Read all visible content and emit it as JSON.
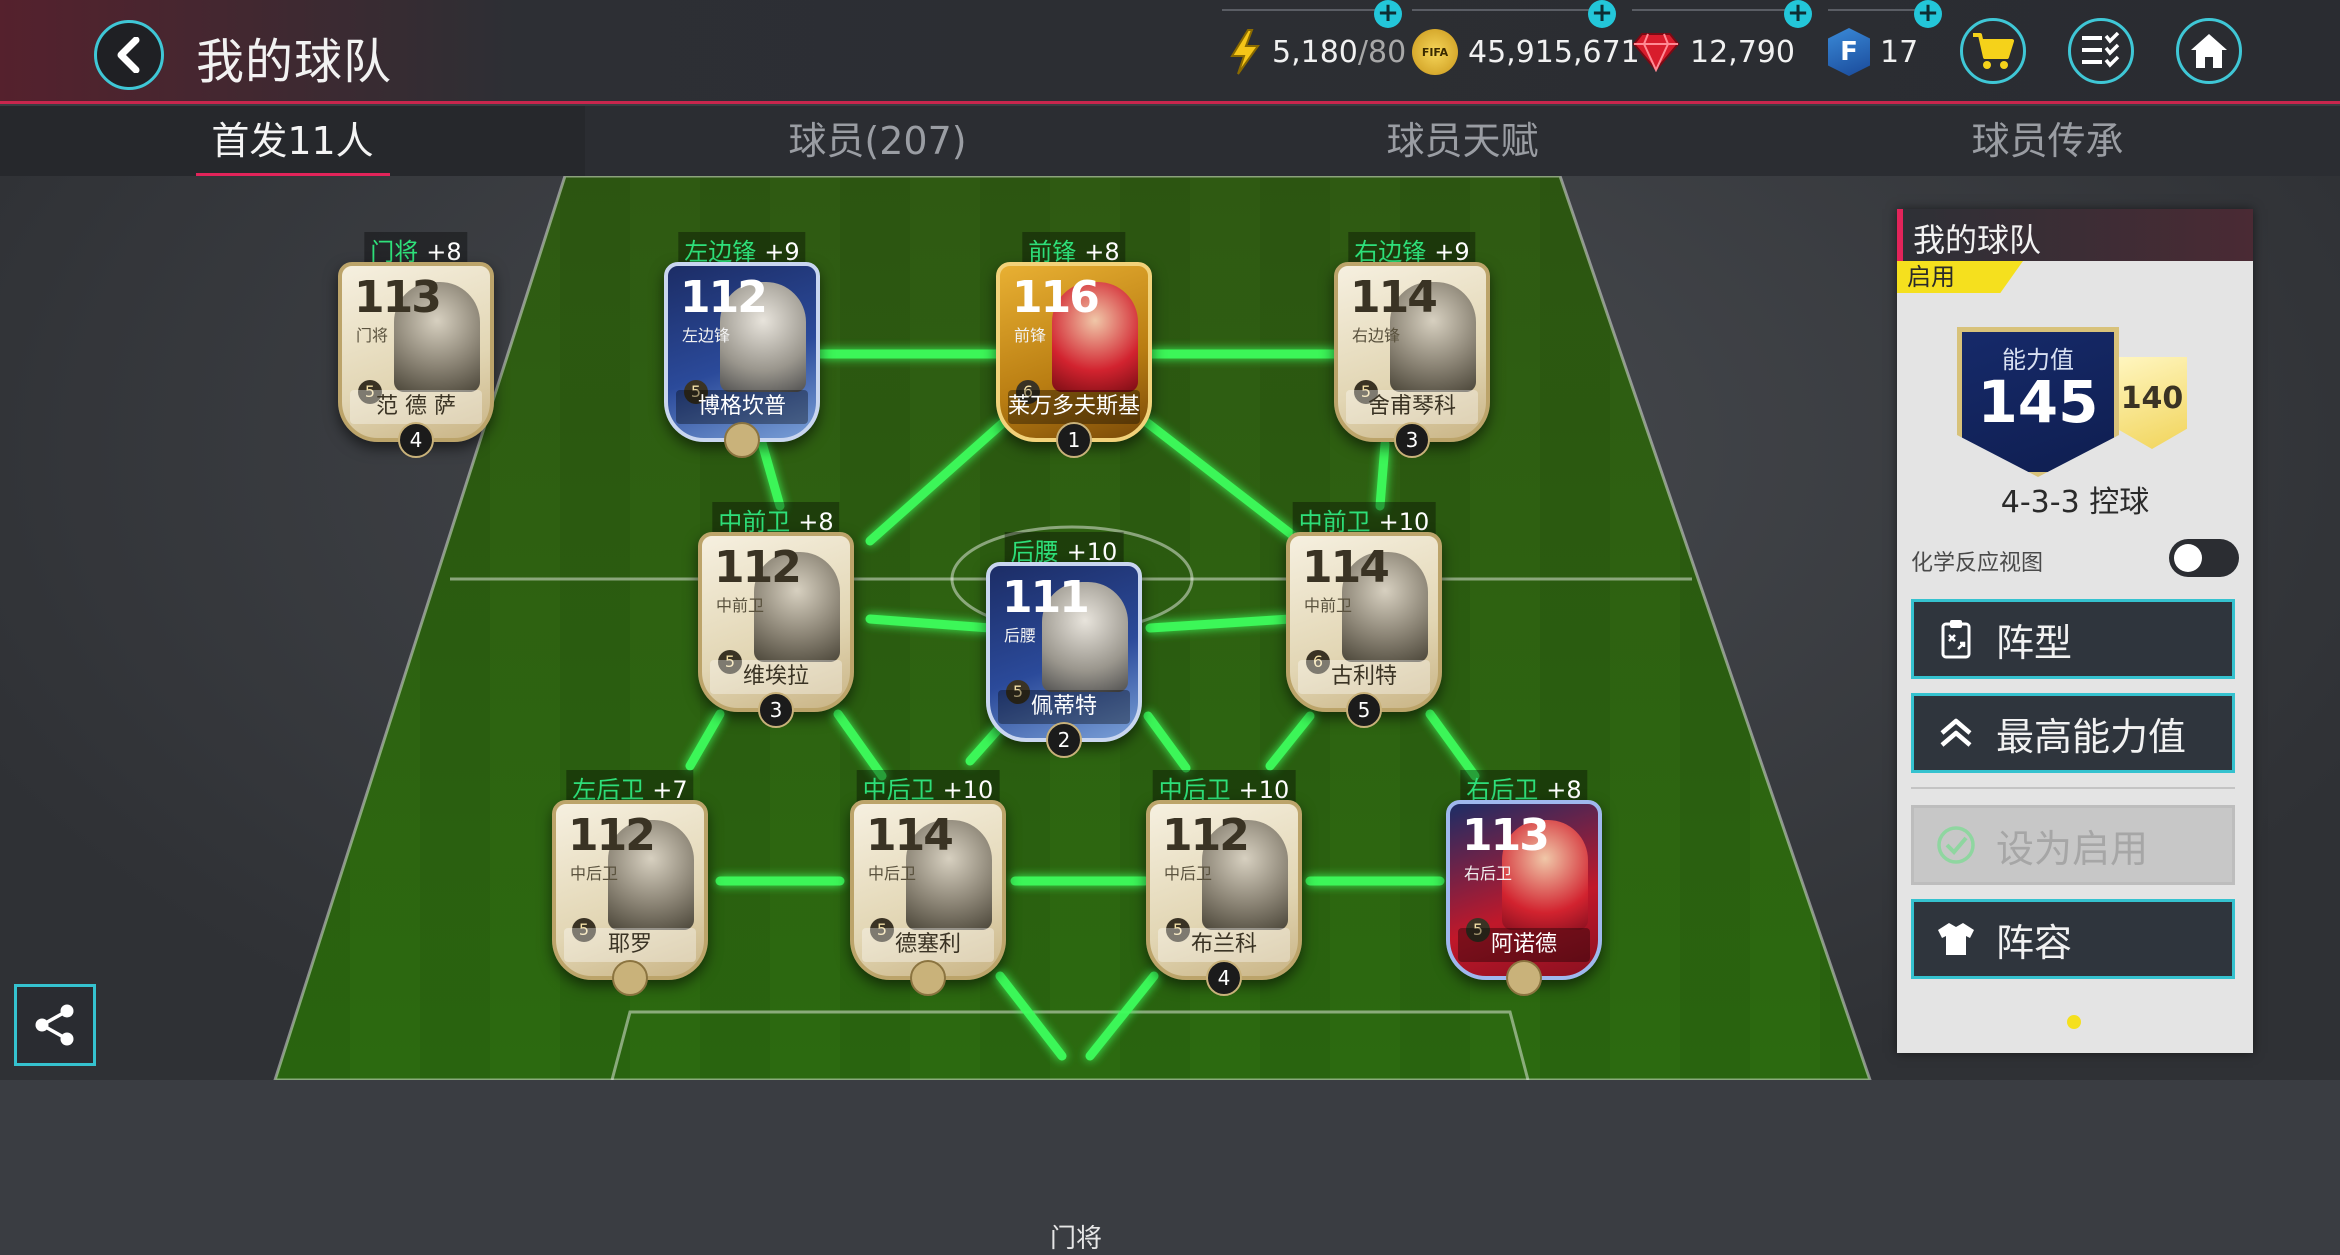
{
  "header": {
    "title": "我的球队",
    "resources": [
      {
        "icon": "lightning-icon",
        "value": "5,180",
        "sub": "/80"
      },
      {
        "icon": "fifa-coin-icon",
        "value": "45,915,671"
      },
      {
        "icon": "ruby-gem-icon",
        "value": "12,790"
      },
      {
        "icon": "fifa-points-icon",
        "value": "17"
      }
    ],
    "coin_icon_text": "FIFA",
    "points_icon_text": "F"
  },
  "tabs": [
    {
      "label": "首发11人",
      "active": true
    },
    {
      "label": "球员(207)",
      "active": false
    },
    {
      "label": "球员天赋",
      "active": false
    },
    {
      "label": "球员传承",
      "active": false
    }
  ],
  "players": [
    {
      "id": "gk",
      "pos_label": "门将",
      "bonus": "+8",
      "rating": "113",
      "card_pos": "门将",
      "name": "范 德 萨",
      "chem": "5",
      "rank": "4",
      "style": "icon"
    },
    {
      "id": "lw",
      "pos_label": "左边锋",
      "bonus": "+9",
      "rating": "112",
      "card_pos": "左边锋",
      "name": "博格坎普",
      "chem": "5",
      "rank": "",
      "style": "blue"
    },
    {
      "id": "st",
      "pos_label": "前锋",
      "bonus": "+8",
      "rating": "116",
      "card_pos": "前锋",
      "name": "莱万多夫斯基",
      "chem": "6",
      "rank": "1",
      "style": "gold"
    },
    {
      "id": "rw",
      "pos_label": "右边锋",
      "bonus": "+9",
      "rating": "114",
      "card_pos": "右边锋",
      "name": "舍甫琴科",
      "chem": "5",
      "rank": "3",
      "style": "icon"
    },
    {
      "id": "lcm",
      "pos_label": "中前卫",
      "bonus": "+8",
      "rating": "112",
      "card_pos": "中前卫",
      "name": "维埃拉",
      "chem": "5",
      "rank": "3",
      "style": "icon"
    },
    {
      "id": "cdm",
      "pos_label": "后腰",
      "bonus": "+10",
      "rating": "111",
      "card_pos": "后腰",
      "name": "佩蒂特",
      "chem": "5",
      "rank": "2",
      "style": "blue"
    },
    {
      "id": "rcm",
      "pos_label": "中前卫",
      "bonus": "+10",
      "rating": "114",
      "card_pos": "中前卫",
      "name": "古利特",
      "chem": "6",
      "rank": "5",
      "style": "icon"
    },
    {
      "id": "lb",
      "pos_label": "左后卫",
      "bonus": "+7",
      "rating": "112",
      "card_pos": "中后卫",
      "name": "耶罗",
      "chem": "5",
      "rank": "",
      "style": "icon"
    },
    {
      "id": "lcb",
      "pos_label": "中后卫",
      "bonus": "+10",
      "rating": "114",
      "card_pos": "中后卫",
      "name": "德塞利",
      "chem": "5",
      "rank": "",
      "style": "icon"
    },
    {
      "id": "rcb",
      "pos_label": "中后卫",
      "bonus": "+10",
      "rating": "112",
      "card_pos": "中后卫",
      "name": "布兰科",
      "chem": "5",
      "rank": "4",
      "style": "icon"
    },
    {
      "id": "rb",
      "pos_label": "右后卫",
      "bonus": "+8",
      "rating": "113",
      "card_pos": "右后卫",
      "name": "阿诺德",
      "chem": "5",
      "rank": "",
      "style": "red"
    }
  ],
  "pitch": {
    "gk_label": "门将"
  },
  "panel": {
    "title": "我的球队",
    "active_tag": "启用",
    "rating_label": "能力值",
    "rating_value": "145",
    "sub_rating": "140",
    "formation": "4-3-3 控球",
    "chem_view_label": "化学反应视图",
    "chem_view_on": false,
    "buttons": [
      {
        "label": "阵型",
        "icon": "clipboard-tactics-icon",
        "enabled": true
      },
      {
        "label": "最高能力值",
        "icon": "double-chevron-up-icon",
        "enabled": true
      },
      {
        "label": "设为启用",
        "icon": "check-circle-icon",
        "enabled": false
      },
      {
        "label": "阵容",
        "icon": "jersey-icon",
        "enabled": true
      }
    ]
  },
  "colors": {
    "accent": "#35c2cf",
    "highlight": "#e2245a",
    "link_line": "#3cff5c",
    "position_text": "#2ee07a",
    "active_tag": "#f5e01e"
  }
}
